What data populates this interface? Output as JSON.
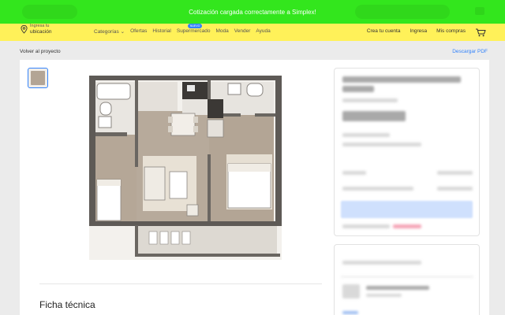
{
  "toast": {
    "message": "Cotización cargada correctamente a Simplex!"
  },
  "navbar": {
    "location_small": "Ingresa tu",
    "location_big": "ubicación",
    "links": [
      "Categorías ⌄",
      "Ofertas",
      "Historial",
      "Supermercado",
      "Moda",
      "Vender",
      "Ayuda"
    ],
    "supermercado_badge": "NUEVO",
    "account": [
      "Crea tu cuenta",
      "Ingresa",
      "Mis compras"
    ]
  },
  "project": {
    "back_label": "Volver al proyecto",
    "pdf_label": "Descargar PDF",
    "section_title": "Ficha técnica"
  },
  "colors": {
    "brand_yellow": "#fff159",
    "toast_green": "#33e61d",
    "accent_blue": "#3483fa",
    "wall": "#5e5a56",
    "floor_wood": "#b3a595"
  },
  "icons": [
    "location-pin-icon",
    "cart-icon"
  ]
}
